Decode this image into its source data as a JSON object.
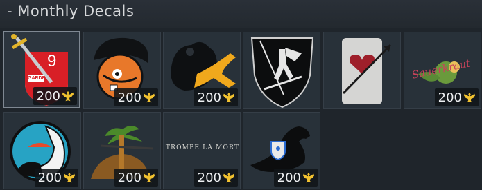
{
  "section": {
    "title": "- Monthly Decals"
  },
  "decals": [
    {
      "price": "200",
      "currency_icon": "golden-eagle-icon",
      "selected": true
    },
    {
      "price": "200",
      "currency_icon": "golden-eagle-icon"
    },
    {
      "price": "200",
      "currency_icon": "golden-eagle-icon"
    },
    {
      "price": "",
      "currency_icon": ""
    },
    {
      "price": "",
      "currency_icon": ""
    },
    {
      "price": "200",
      "currency_icon": "golden-eagle-icon"
    },
    {
      "price": "200",
      "currency_icon": "golden-eagle-icon"
    },
    {
      "price": "200",
      "currency_icon": "golden-eagle-icon"
    },
    {
      "price": "200",
      "currency_icon": "golden-eagle-icon"
    },
    {
      "price": "200",
      "currency_icon": "golden-eagle-icon"
    }
  ],
  "decal_texts": {
    "garde_number": "9",
    "garde_label": "GARDE",
    "trompe_la_mort": "TROMPE LA MORT",
    "sauerkraut_script": "Sauerkraut"
  },
  "colors": {
    "background": "#1f252b",
    "tile": "#283139",
    "tile_border": "#353e47",
    "selected_border": "#7f8892",
    "price_text": "#eef0f2",
    "eagle_gold": "#f2c230"
  }
}
